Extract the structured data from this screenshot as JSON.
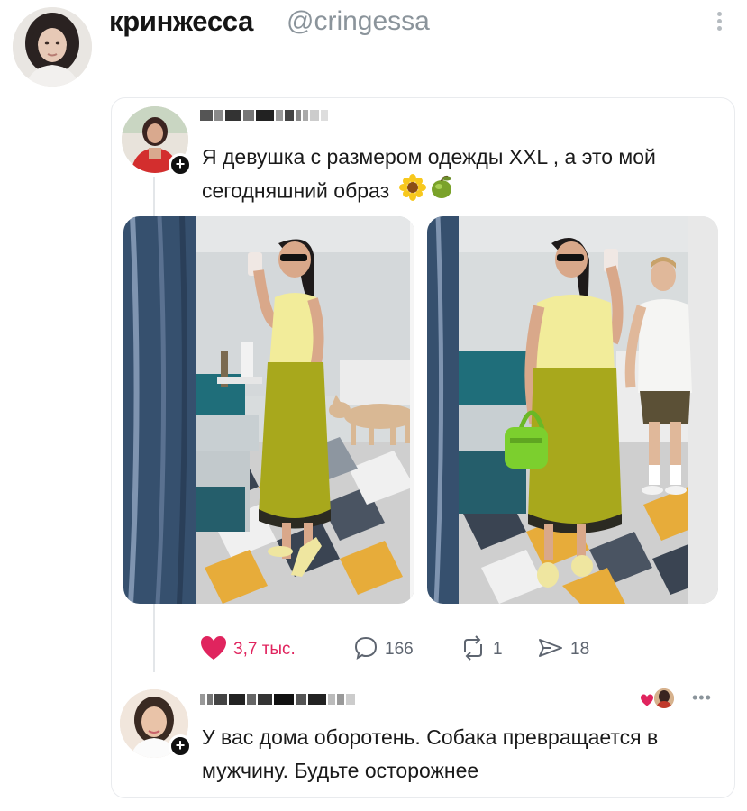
{
  "header": {
    "display_name": "кринжесса",
    "handle": "@cringessa"
  },
  "post": {
    "text": "Я девушка с размером одежды XXL , а это мой сегодняшний образ",
    "emojis": [
      "sunflower-emoji",
      "olive-emoji"
    ]
  },
  "actions": {
    "likes": "3,7 тыс.",
    "comments": "166",
    "reposts": "1",
    "shares": "18"
  },
  "reply": {
    "text": "У вас дома оборотень. Собака превращается в мужчину. Будьте осторожнее"
  },
  "colors": {
    "like": "#e0245e",
    "skirt": "#a8a81c",
    "top": "#f2ec9a",
    "bag": "#7ccf2e"
  },
  "icons": [
    "heart-icon",
    "comment-icon",
    "repost-icon",
    "share-icon",
    "plus-icon",
    "more-icon"
  ]
}
